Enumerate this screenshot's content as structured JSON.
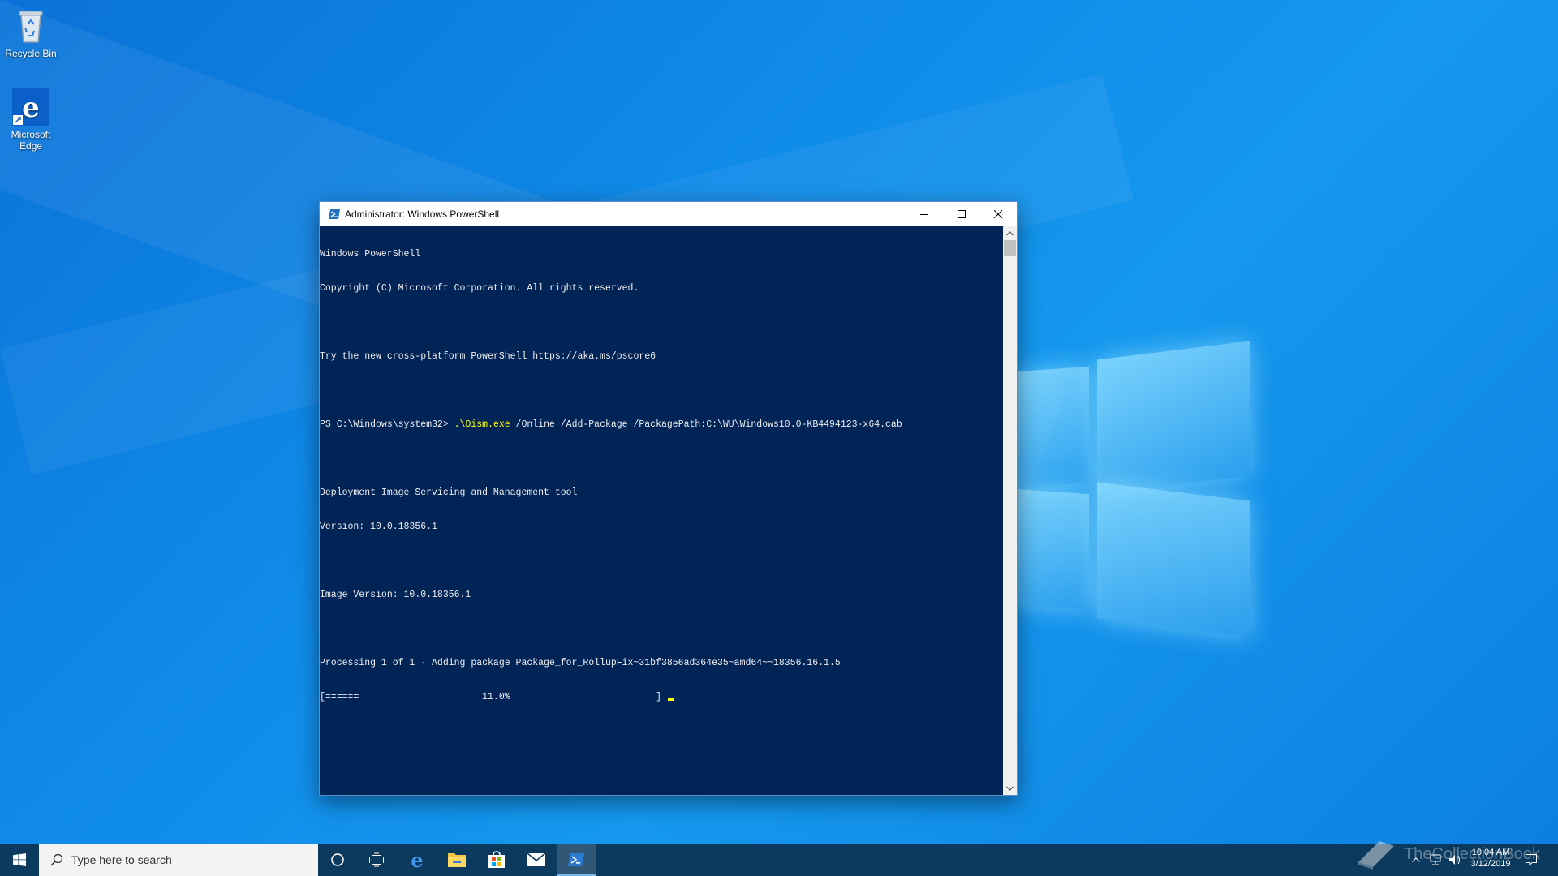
{
  "desktop": {
    "icons": [
      {
        "label": "Recycle Bin",
        "icon": "recycle-bin-icon"
      },
      {
        "label": "Microsoft Edge",
        "icon": "edge-icon"
      }
    ]
  },
  "window": {
    "title": "Administrator: Windows PowerShell",
    "icon": "powershell-icon",
    "console": {
      "lines": [
        "Windows PowerShell",
        "Copyright (C) Microsoft Corporation. All rights reserved.",
        "",
        "Try the new cross-platform PowerShell https://aka.ms/pscore6",
        "",
        "",
        "",
        "Deployment Image Servicing and Management tool",
        "Version: 10.0.18356.1",
        "",
        "Image Version: 10.0.18356.1",
        "",
        "Processing 1 of 1 - Adding package Package_for_RollupFix~31bf3856ad364e35~amd64~~18356.16.1.5"
      ],
      "prompt": "PS C:\\Windows\\system32> ",
      "command_exe": ".\\Dism.exe",
      "command_args": " /Online /Add-Package /PackagePath:C:\\WU\\Windows10.0-KB4494123-x64.cab",
      "progress_line": "[======                      11.0%                          ] ",
      "progress_percent": 11.0
    }
  },
  "taskbar": {
    "search_placeholder": "Type here to search",
    "apps": [
      "cortana-icon",
      "task-view-icon",
      "edge-icon",
      "file-explorer-icon",
      "store-icon",
      "mail-icon",
      "powershell-icon"
    ],
    "active_app": "powershell-icon",
    "clock_time": "10:04 AM",
    "clock_date": "3/12/2019",
    "watermark": "TheCollectionBook"
  },
  "colors": {
    "console_bg": "#012456",
    "console_fg": "#eeedf0",
    "command_fg": "#ffff00",
    "taskbar_bg": "#0c3a5e"
  }
}
